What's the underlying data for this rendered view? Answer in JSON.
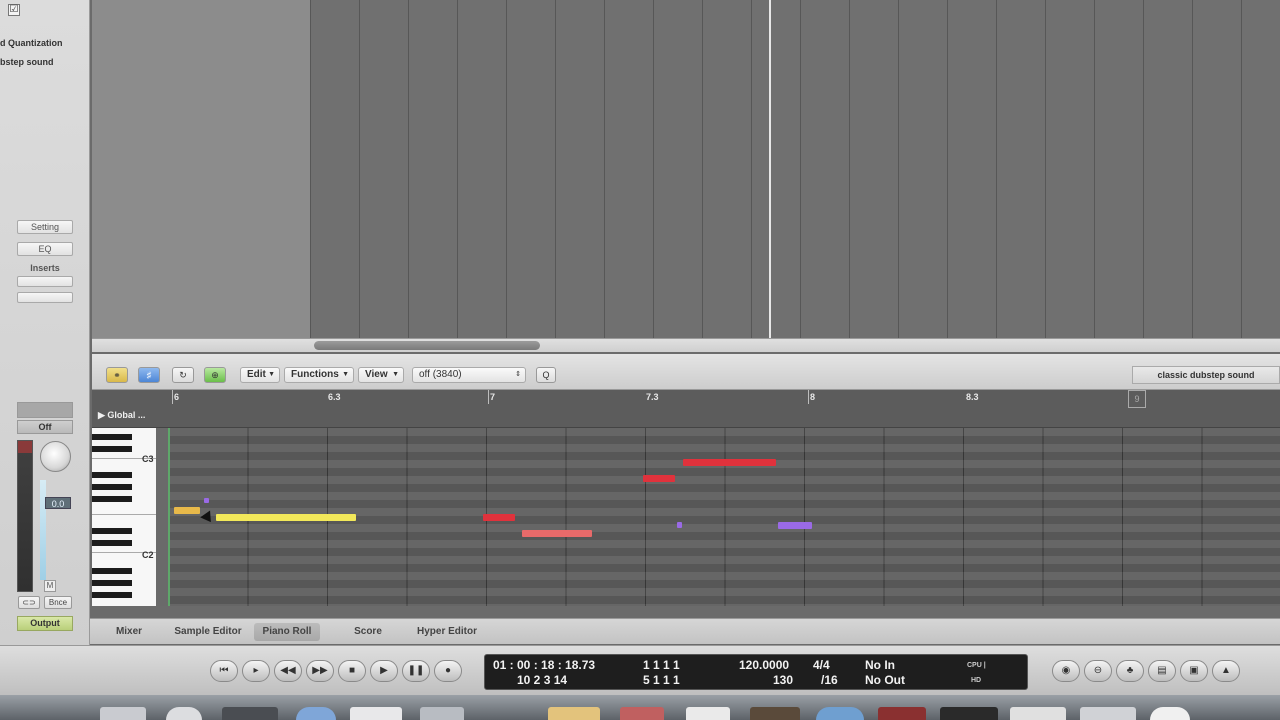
{
  "inspector": {
    "checkbox_mark": "☑",
    "quantization_label": "d Quantization",
    "region_label": "bstep sound",
    "setting_label": "Setting",
    "eq_label": "EQ",
    "inserts_label": "Inserts",
    "off_label": "Off",
    "volume_value": "0.0",
    "m_label": "M",
    "link_label": "⊂⊃",
    "bnce_label": "Bnce",
    "output_label": "Output"
  },
  "editor_toolbar": {
    "edit_menu": "Edit",
    "functions_menu": "Functions",
    "view_menu": "View",
    "quantize_value": "off (3840)",
    "q_button": "Q",
    "region_name": "classic dubstep sound"
  },
  "piano_roll": {
    "global_label": "▶ Global ...",
    "ruler_marks": [
      "6",
      "6.3",
      "7",
      "7.3",
      "8",
      "8.3",
      "9"
    ],
    "key_labels": [
      "C3",
      "C2"
    ],
    "note_colors": {
      "yellow": "#f2e85a",
      "orange": "#e8b94a",
      "red": "#e0323c",
      "salmon": "#e86a6a",
      "purple": "#9a6ae6"
    }
  },
  "tabs": [
    "Mixer",
    "Sample Editor",
    "Piano Roll",
    "Score",
    "Hyper Editor"
  ],
  "active_tab": "Piano Roll",
  "transport": {
    "smpte_time": "01 : 00 : 18 : 18.73",
    "smpte_sub": "10   2   3   14",
    "bars_pos": "1   1   1   1",
    "bars_sub": "5   1   1   1",
    "tempo": "120.0000",
    "tempo_sub": "130",
    "signature": "4/4",
    "division": "/16",
    "midi_in": "No In",
    "midi_out": "No Out",
    "cpu_label": "CPU |",
    "hd_label": "HD"
  }
}
